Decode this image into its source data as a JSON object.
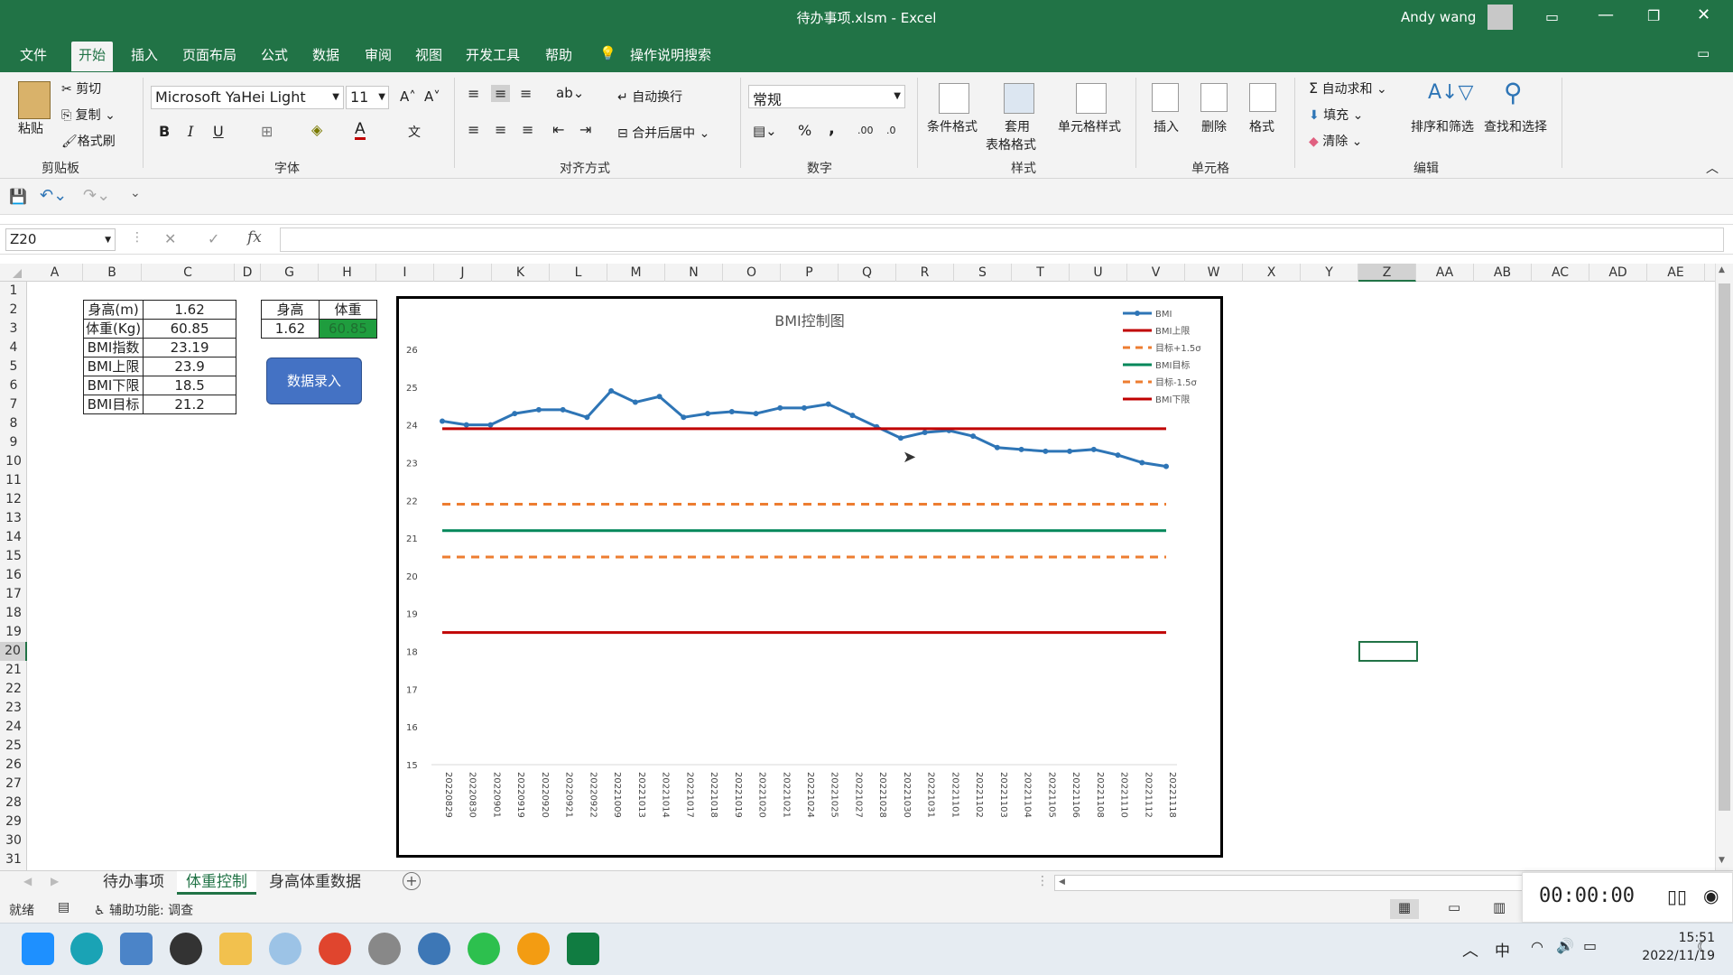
{
  "window": {
    "title": "待办事项.xlsm - Excel",
    "user": "Andy wang"
  },
  "tabs": [
    "文件",
    "开始",
    "插入",
    "页面布局",
    "公式",
    "数据",
    "审阅",
    "视图",
    "开发工具",
    "帮助"
  ],
  "active_tab": "开始",
  "search_label": "操作说明搜索",
  "ribbon": {
    "clipboard": {
      "paste": "粘贴",
      "cut": "剪切",
      "copy": "复制",
      "format_painter": "格式刷",
      "label": "剪贴板"
    },
    "font": {
      "name": "Microsoft YaHei Light",
      "size": "11",
      "label": "字体",
      "bold": "B",
      "italic": "I",
      "underline": "U"
    },
    "alignment": {
      "wrap": "自动换行",
      "merge": "合并后居中",
      "label": "对齐方式"
    },
    "number": {
      "format": "常规",
      "label": "数字",
      "percent": "%",
      "comma": ","
    },
    "styles": {
      "conditional": "条件格式",
      "table": "套用",
      "table2": "表格格式",
      "cell": "单元格样式",
      "label": "样式"
    },
    "cells": {
      "insert": "插入",
      "delete": "删除",
      "format": "格式",
      "label": "单元格"
    },
    "editing": {
      "autosum": "自动求和",
      "fill": "填充",
      "clear": "清除",
      "sort": "排序和筛选",
      "find": "查找和选择",
      "label": "编辑"
    }
  },
  "name_box": "Z20",
  "fx": "fx",
  "columns": [
    "A",
    "B",
    "C",
    "D",
    "G",
    "H",
    "I",
    "J",
    "K",
    "L",
    "M",
    "N",
    "O",
    "P",
    "Q",
    "R",
    "S",
    "T",
    "U",
    "V",
    "W",
    "X",
    "Y",
    "Z",
    "AA",
    "AB",
    "AC",
    "AD",
    "AE"
  ],
  "rows": [
    "1",
    "2",
    "3",
    "4",
    "5",
    "6",
    "7",
    "8",
    "9",
    "10",
    "11",
    "12",
    "13",
    "14",
    "15",
    "16",
    "17",
    "18",
    "19",
    "20",
    "21",
    "22",
    "23",
    "24",
    "25",
    "26",
    "27",
    "28",
    "29",
    "30",
    "31"
  ],
  "table1": [
    [
      "身高(m)",
      "1.62"
    ],
    [
      "体重(Kg)",
      "60.85"
    ],
    [
      "BMI指数",
      "23.19"
    ],
    [
      "BMI上限",
      "23.9"
    ],
    [
      "BMI下限",
      "18.5"
    ],
    [
      "BMI目标",
      "21.2"
    ]
  ],
  "table2": {
    "headers": [
      "身高",
      "体重"
    ],
    "values": [
      "1.62",
      "60.85"
    ]
  },
  "entry_button": "数据录入",
  "chart_data": {
    "type": "line",
    "title": "BMI控制图",
    "ylim": [
      15,
      26
    ],
    "yticks": [
      "15",
      "16",
      "17",
      "18",
      "19",
      "20",
      "21",
      "22",
      "23",
      "24",
      "25",
      "26"
    ],
    "categories": [
      "20220829",
      "20220830",
      "20220901",
      "20220919",
      "20220920",
      "20220921",
      "20220922",
      "20221009",
      "20221013",
      "20221014",
      "20221017",
      "20221018",
      "20221019",
      "20221020",
      "20221021",
      "20221024",
      "20221025",
      "20221027",
      "20221028",
      "20221030",
      "20221031",
      "20221101",
      "20221102",
      "20221103",
      "20221104",
      "20221105",
      "20221106",
      "20221108",
      "20221110",
      "20221112",
      "20221118"
    ],
    "series": [
      {
        "name": "BMI",
        "color": "#2e75b6",
        "values": [
          24.1,
          24.0,
          24.0,
          24.3,
          24.4,
          24.4,
          24.2,
          24.9,
          24.6,
          24.75,
          24.2,
          24.3,
          24.35,
          24.3,
          24.45,
          24.45,
          24.55,
          24.25,
          23.95,
          23.65,
          23.8,
          23.85,
          23.7,
          23.4,
          23.35,
          23.3,
          23.3,
          23.35,
          23.2,
          23.0,
          22.9
        ]
      },
      {
        "name": "BMI上限",
        "color": "#c00000",
        "constant": 23.9
      },
      {
        "name": "目标+1.5σ",
        "color": "#ed7d31",
        "constant": 21.9,
        "dashed": true
      },
      {
        "name": "BMI目标",
        "color": "#00875a",
        "constant": 21.2
      },
      {
        "name": "目标-1.5σ",
        "color": "#ed7d31",
        "constant": 20.5,
        "dashed": true
      },
      {
        "name": "BMI下限",
        "color": "#c00000",
        "constant": 18.5
      }
    ]
  },
  "sheet_tabs": [
    "待办事项",
    "体重控制",
    "身高体重数据"
  ],
  "active_sheet": "体重控制",
  "status": {
    "ready": "就绪",
    "accessibility": "辅助功能: 调查"
  },
  "recorder_time": "00:00:00",
  "clock": {
    "time": "15:51",
    "date": "2022/11/19"
  },
  "tray": {
    "ime": "中"
  }
}
